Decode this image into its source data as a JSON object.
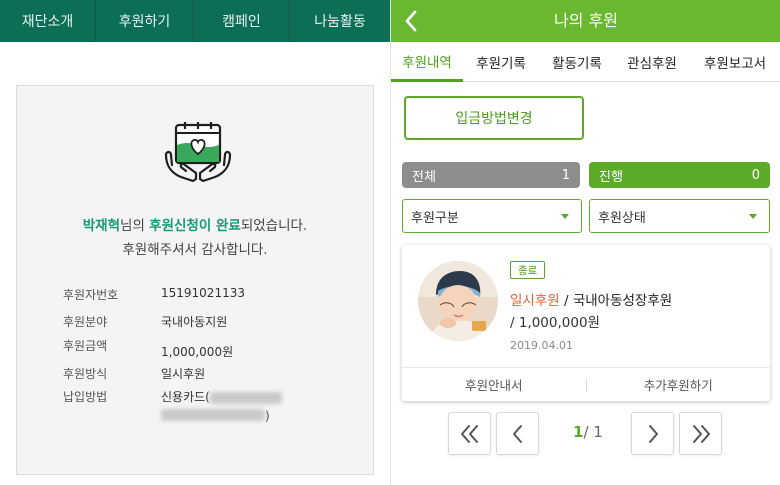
{
  "left": {
    "nav": [
      "재단소개",
      "후원하기",
      "캠페인",
      "나눔활동"
    ],
    "msg": {
      "name": "박재혁",
      "mid1": "님의 ",
      "highlight": "후원신청이 완료",
      "mid2": "되었습니다.",
      "line2": "후원해주셔서 감사합니다."
    },
    "info": [
      {
        "label": "후원자번호",
        "value": "15191021133"
      },
      {
        "label": "후원분야",
        "value": "국내아동지원"
      },
      {
        "label": "후원금액",
        "value": "1,000,000원"
      },
      {
        "label": "후원방식",
        "value": "일시후원"
      },
      {
        "label": "납입방법",
        "value": "신용카드(",
        "tail": ")"
      }
    ]
  },
  "right": {
    "title": "나의 후원",
    "tabs": [
      "후원내역",
      "후원기록",
      "활동기록",
      "관심후원",
      "후원보고서"
    ],
    "pay_button": "입금방법변경",
    "counts": {
      "all_label": "전체",
      "all_value": "1",
      "ongoing_label": "진행",
      "ongoing_value": "0"
    },
    "selects": {
      "type": "후원구분",
      "status": "후원상태"
    },
    "item": {
      "badge": "종료",
      "kind": "일시후원",
      "sep": " / ",
      "name": "국내아동성장후원",
      "amount": "/ 1,000,000원",
      "date": "2019.04.01",
      "action1": "후원안내서",
      "action2": "추가후원하기"
    },
    "pager": {
      "current": "1",
      "total": "/ 1"
    }
  },
  "colors": {
    "left_nav": "#0c6e57",
    "right_header": "#6ab830",
    "accent_green": "#5aa72a",
    "highlight_teal": "#1b9a74",
    "accent_red": "#e5603a"
  }
}
